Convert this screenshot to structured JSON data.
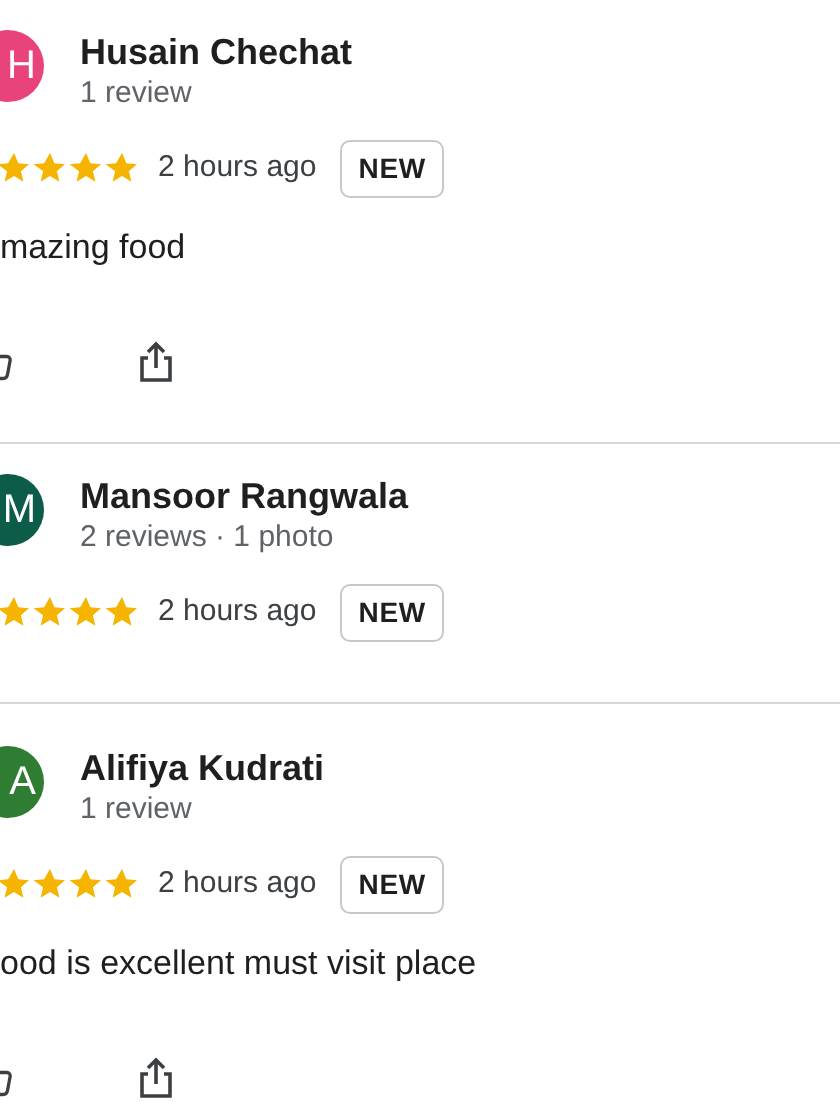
{
  "reviews": [
    {
      "avatar_letter": "H",
      "color": "#e8437a",
      "name": "Husain Chechat",
      "meta": "1 review",
      "stars": 4,
      "time": "2 hours ago",
      "badge": "NEW",
      "text": "mazing food",
      "has_actions": true
    },
    {
      "avatar_letter": "M",
      "color": "#0d5c4a",
      "name": "Mansoor Rangwala",
      "meta": "2 reviews · 1 photo",
      "stars": 4,
      "time": "2 hours ago",
      "badge": "NEW",
      "has_actions": false
    },
    {
      "avatar_letter": "A",
      "color": "#2e7d32",
      "name": "Alifiya Kudrati",
      "meta": "1 review",
      "stars": 4,
      "time": "2 hours ago",
      "badge": "NEW",
      "text": "ood is excellent must visit place",
      "has_actions": true
    }
  ]
}
